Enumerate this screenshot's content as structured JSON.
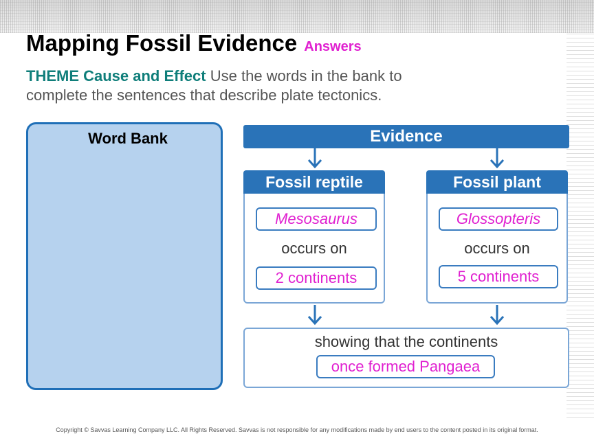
{
  "header": {
    "title": "Mapping Fossil Evidence",
    "answers_label": "Answers"
  },
  "instructions": {
    "theme_label": "THEME Cause and Effect",
    "text": "Use the words in the bank to complete the sentences that describe plate tectonics."
  },
  "word_bank": {
    "title": "Word Bank"
  },
  "diagram": {
    "evidence_label": "Evidence",
    "columns": [
      {
        "header": "Fossil reptile",
        "fossil_answer": "Mesosaurus",
        "connector": "occurs on",
        "count_answer": "2 continents"
      },
      {
        "header": "Fossil plant",
        "fossil_answer": "Glossopteris",
        "connector": "occurs on",
        "count_answer": "5 continents"
      }
    ],
    "result_text": "showing that the continents",
    "result_answer": "once formed Pangaea"
  },
  "footer": {
    "copyright": "Copyright © Savvas Learning Company LLC. All Rights Reserved. Savvas is not responsible for any modifications made by end users to the content posted in its original format."
  },
  "colors": {
    "title": "#000000",
    "answers": "#e020d0",
    "theme": "#0f7e7a",
    "evidence_blue": "#2a73b8",
    "word_bank_fill": "#b6d2ee",
    "answer_text": "#e020d0"
  }
}
